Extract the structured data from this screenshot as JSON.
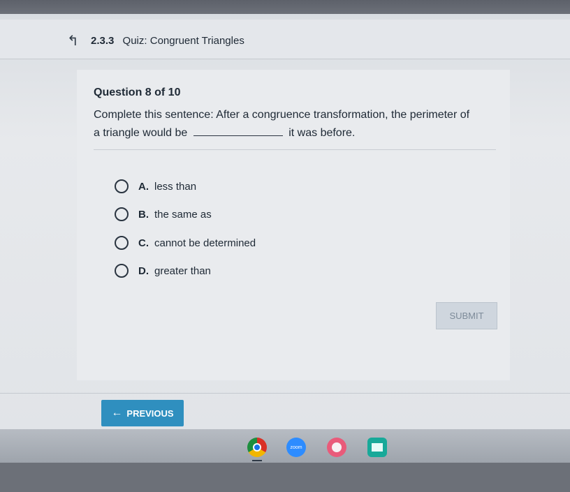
{
  "header": {
    "quiz_number": "2.3.3",
    "quiz_label": "Quiz:",
    "quiz_title": "Congruent Triangles"
  },
  "question": {
    "counter": "Question 8 of 10",
    "text_line1": "Complete this sentence: After a congruence transformation, the perimeter of",
    "text_line2_before": "a triangle would be",
    "text_line2_after": "it was before."
  },
  "options": [
    {
      "letter": "A.",
      "text": "less than"
    },
    {
      "letter": "B.",
      "text": "the same as"
    },
    {
      "letter": "C.",
      "text": "cannot be determined"
    },
    {
      "letter": "D.",
      "text": "greater than"
    }
  ],
  "buttons": {
    "submit": "SUBMIT",
    "previous": "PREVIOUS"
  },
  "shelf": {
    "zoom_label": "zoom"
  }
}
